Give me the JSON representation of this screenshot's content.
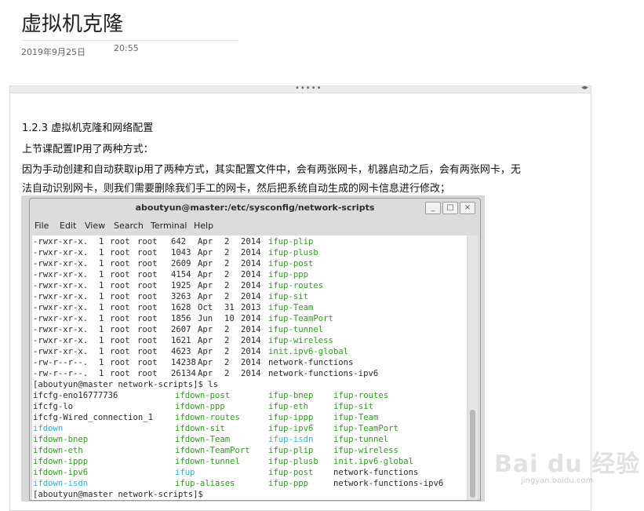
{
  "article": {
    "title": "虚拟机克隆",
    "date": "2019年9月25日",
    "time": "20:55"
  },
  "panel": {
    "grip": "•••••",
    "arrows": "◂▸"
  },
  "content": {
    "heading": "1.2.3 虚拟机克隆和网络配置",
    "line1": "上节课配置IP用了两种方式：",
    "line2": "因为手动创建和自动获取ip用了两种方式，其实配置文件中，会有两张网卡，机器启动之后，会有两张网卡，无",
    "line3": "法自动识别网卡，则我们需要删除我们手工的网卡，然后把系统自动生成的网卡信息进行修改；"
  },
  "terminal": {
    "title": "aboutyun@master:/etc/sysconfig/network-scripts",
    "buttons": [
      "_",
      "□",
      "×"
    ],
    "menu": [
      "File",
      "Edit",
      "View",
      "Search",
      "Terminal",
      "Help"
    ],
    "ls_long": [
      {
        "perm": "-rwxr-xr-x.",
        "links": "1",
        "owner": "root",
        "group": "root",
        "size": "642",
        "mon": "Apr",
        "day": "2",
        "year": "2014",
        "name": "ifup-plip",
        "color": "green"
      },
      {
        "perm": "-rwxr-xr-x.",
        "links": "1",
        "owner": "root",
        "group": "root",
        "size": "1043",
        "mon": "Apr",
        "day": "2",
        "year": "2014",
        "name": "ifup-plusb",
        "color": "green"
      },
      {
        "perm": "-rwxr-xr-x.",
        "links": "1",
        "owner": "root",
        "group": "root",
        "size": "2609",
        "mon": "Apr",
        "day": "2",
        "year": "2014",
        "name": "ifup-post",
        "color": "green"
      },
      {
        "perm": "-rwxr-xr-x.",
        "links": "1",
        "owner": "root",
        "group": "root",
        "size": "4154",
        "mon": "Apr",
        "day": "2",
        "year": "2014",
        "name": "ifup-ppp",
        "color": "green"
      },
      {
        "perm": "-rwxr-xr-x.",
        "links": "1",
        "owner": "root",
        "group": "root",
        "size": "1925",
        "mon": "Apr",
        "day": "2",
        "year": "2014",
        "name": "ifup-routes",
        "color": "green"
      },
      {
        "perm": "-rwxr-xr-x.",
        "links": "1",
        "owner": "root",
        "group": "root",
        "size": "3263",
        "mon": "Apr",
        "day": "2",
        "year": "2014",
        "name": "ifup-sit",
        "color": "green"
      },
      {
        "perm": "-rwxr-xr-x.",
        "links": "1",
        "owner": "root",
        "group": "root",
        "size": "1628",
        "mon": "Oct",
        "day": "31",
        "year": "2013",
        "name": "ifup-Team",
        "color": "green"
      },
      {
        "perm": "-rwxr-xr-x.",
        "links": "1",
        "owner": "root",
        "group": "root",
        "size": "1856",
        "mon": "Jun",
        "day": "10",
        "year": "2014",
        "name": "ifup-TeamPort",
        "color": "green"
      },
      {
        "perm": "-rwxr-xr-x.",
        "links": "1",
        "owner": "root",
        "group": "root",
        "size": "2607",
        "mon": "Apr",
        "day": "2",
        "year": "2014",
        "name": "ifup-tunnel",
        "color": "green"
      },
      {
        "perm": "-rwxr-xr-x.",
        "links": "1",
        "owner": "root",
        "group": "root",
        "size": "1621",
        "mon": "Apr",
        "day": "2",
        "year": "2014",
        "name": "ifup-wireless",
        "color": "green"
      },
      {
        "perm": "-rwxr-xr-x.",
        "links": "1",
        "owner": "root",
        "group": "root",
        "size": "4623",
        "mon": "Apr",
        "day": "2",
        "year": "2014",
        "name": "init.ipv6-global",
        "color": "green"
      },
      {
        "perm": "-rw-r--r--.",
        "links": "1",
        "owner": "root",
        "group": "root",
        "size": "14238",
        "mon": "Apr",
        "day": "2",
        "year": "2014",
        "name": "network-functions",
        "color": "plain"
      },
      {
        "perm": "-rw-r--r--.",
        "links": "1",
        "owner": "root",
        "group": "root",
        "size": "26134",
        "mon": "Apr",
        "day": "2",
        "year": "2014",
        "name": "network-functions-ipv6",
        "color": "plain"
      }
    ],
    "prompt_ls": "[aboutyun@master network-scripts]$ ls",
    "ls_rows": [
      [
        {
          "t": "ifcfg-eno16777736",
          "c": "plain"
        },
        {
          "t": "ifdown-post",
          "c": "green"
        },
        {
          "t": "ifup-bnep",
          "c": "green"
        },
        {
          "t": "ifup-routes",
          "c": "green"
        }
      ],
      [
        {
          "t": "ifcfg-lo",
          "c": "plain"
        },
        {
          "t": "ifdown-ppp",
          "c": "green"
        },
        {
          "t": "ifup-eth",
          "c": "green"
        },
        {
          "t": "ifup-sit",
          "c": "green"
        }
      ],
      [
        {
          "t": "ifcfg-Wired_connection_1",
          "c": "plain"
        },
        {
          "t": "ifdown-routes",
          "c": "green"
        },
        {
          "t": "ifup-ippp",
          "c": "green"
        },
        {
          "t": "ifup-Team",
          "c": "green"
        }
      ],
      [
        {
          "t": "ifdown",
          "c": "cyan"
        },
        {
          "t": "ifdown-sit",
          "c": "green"
        },
        {
          "t": "ifup-ipv6",
          "c": "green"
        },
        {
          "t": "ifup-TeamPort",
          "c": "green"
        }
      ],
      [
        {
          "t": "ifdown-bnep",
          "c": "green"
        },
        {
          "t": "ifdown-Team",
          "c": "green"
        },
        {
          "t": "ifup-isdn",
          "c": "cyan"
        },
        {
          "t": "ifup-tunnel",
          "c": "green"
        }
      ],
      [
        {
          "t": "ifdown-eth",
          "c": "green"
        },
        {
          "t": "ifdown-TeamPort",
          "c": "green"
        },
        {
          "t": "ifup-plip",
          "c": "green"
        },
        {
          "t": "ifup-wireless",
          "c": "green"
        }
      ],
      [
        {
          "t": "ifdown-ippp",
          "c": "green"
        },
        {
          "t": "ifdown-tunnel",
          "c": "green"
        },
        {
          "t": "ifup-plusb",
          "c": "green"
        },
        {
          "t": "init.ipv6-global",
          "c": "green"
        }
      ],
      [
        {
          "t": "ifdown-ipv6",
          "c": "green"
        },
        {
          "t": "ifup",
          "c": "cyan"
        },
        {
          "t": "ifup-post",
          "c": "green"
        },
        {
          "t": "network-functions",
          "c": "plain"
        }
      ],
      [
        {
          "t": "ifdown-isdn",
          "c": "cyan"
        },
        {
          "t": "ifup-aliases",
          "c": "green"
        },
        {
          "t": "ifup-ppp",
          "c": "green"
        },
        {
          "t": "network-functions-ipv6",
          "c": "plain"
        }
      ]
    ],
    "prompt_end": "[aboutyun@master network-scripts]$ "
  },
  "watermark": {
    "brand": "Bai du 经验",
    "site": "jingyan.baidu.com"
  },
  "colors": {
    "exec_green": "#2f9b1f",
    "link_cyan": "#2bb3d1"
  }
}
